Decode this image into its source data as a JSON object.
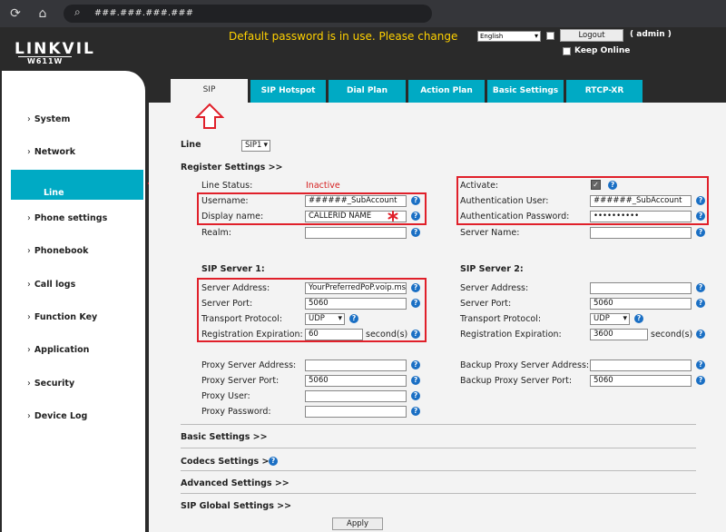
{
  "browser": {
    "url": "###.###.###.###"
  },
  "header": {
    "logo": "LINKVIL",
    "model": "W611W",
    "password_warning": "Default password is in use. Please change",
    "language": "English",
    "logout_label": "Logout",
    "user": "( admin )",
    "keep_online": "Keep Online"
  },
  "sidebar": {
    "items": [
      "System",
      "Network",
      "Line",
      "Phone settings",
      "Phonebook",
      "Call logs",
      "Function Key",
      "Application",
      "Security",
      "Device Log"
    ],
    "active": "Line"
  },
  "tabs": [
    "SIP",
    "SIP Hotspot",
    "Dial Plan",
    "Action Plan",
    "Basic Settings",
    "RTCP-XR"
  ],
  "line": {
    "label": "Line",
    "value": "SIP1"
  },
  "register": {
    "title": "Register Settings >>",
    "line_status_label": "Line Status:",
    "line_status_value": "Inactive",
    "username_label": "Username:",
    "username_value": "######_SubAccount",
    "display_name_label": "Display name:",
    "display_name_value": "CALLERID NAME",
    "realm_label": "Realm:",
    "activate_label": "Activate:",
    "auth_user_label": "Authentication User:",
    "auth_user_value": "######_SubAccount",
    "auth_password_label": "Authentication Password:",
    "auth_password_value": "••••••••••",
    "server_name_label": "Server Name:"
  },
  "sip_server_1": {
    "title": "SIP Server 1:",
    "address_label": "Server Address:",
    "address_value": "YourPreferredPoP.voip.ms",
    "port_label": "Server Port:",
    "port_value": "5060",
    "transport_label": "Transport Protocol:",
    "transport_value": "UDP",
    "expiration_label": "Registration Expiration:",
    "expiration_value": "60",
    "unit": "second(s)"
  },
  "sip_server_2": {
    "title": "SIP Server 2:",
    "address_label": "Server Address:",
    "port_label": "Server Port:",
    "port_value": "5060",
    "transport_label": "Transport Protocol:",
    "transport_value": "UDP",
    "expiration_label": "Registration Expiration:",
    "expiration_value": "3600",
    "unit": "second(s)"
  },
  "proxy": {
    "proxy_address_label": "Proxy Server Address:",
    "proxy_port_label": "Proxy Server Port:",
    "proxy_port_value": "5060",
    "proxy_user_label": "Proxy User:",
    "proxy_password_label": "Proxy Password:",
    "backup_address_label": "Backup Proxy Server Address:",
    "backup_port_label": "Backup Proxy Server Port:",
    "backup_port_value": "5060"
  },
  "sections": {
    "basic": "Basic Settings >>",
    "codecs": "Codecs Settings >>",
    "advanced": "Advanced Settings >>",
    "sip_global": "SIP Global Settings >>"
  },
  "apply_label": "Apply",
  "help_glyph": "?",
  "colors": {
    "accent": "#00aac4",
    "warning": "#ffd100",
    "highlight": "#e0202a",
    "status_inactive": "#d62020"
  }
}
